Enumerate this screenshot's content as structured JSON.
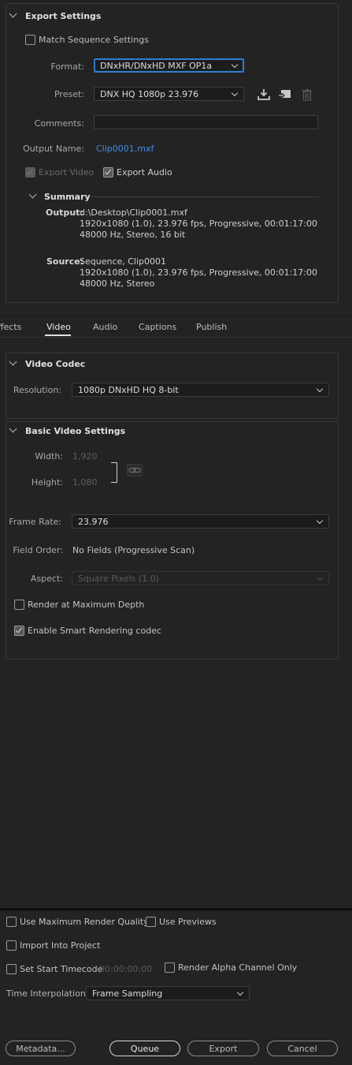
{
  "export_settings": {
    "title": "Export Settings",
    "match_sequence_label": "Match Sequence Settings",
    "format_label": "Format:",
    "format_value": "DNxHR/DNxHD MXF OP1a",
    "preset_label": "Preset:",
    "preset_value": "DNX HQ 1080p 23.976",
    "comments_label": "Comments:",
    "comments_value": "",
    "output_name_label": "Output Name:",
    "output_name_value": "Clip0001.mxf",
    "export_video_label": "Export Video",
    "export_audio_label": "Export Audio"
  },
  "summary": {
    "title": "Summary",
    "output_label": "Output:",
    "output_lines": [
      "d:\\Desktop\\Clip0001.mxf",
      "1920x1080 (1.0), 23.976 fps, Progressive, 00:01:17:00",
      "48000 Hz, Stereo, 16 bit"
    ],
    "source_label": "Source:",
    "source_lines": [
      "Sequence, Clip0001",
      "1920x1080 (1.0), 23.976 fps, Progressive, 00:01:17:00",
      "48000 Hz, Stereo"
    ]
  },
  "tabs": [
    "Effects",
    "Video",
    "Audio",
    "Captions",
    "Publish"
  ],
  "video_codec": {
    "title": "Video Codec",
    "resolution_label": "Resolution:",
    "resolution_value": "1080p DNxHD HQ 8-bit"
  },
  "basic_video": {
    "title": "Basic Video Settings",
    "width_label": "Width:",
    "width_value": "1,920",
    "height_label": "Height:",
    "height_value": "1,080",
    "frame_rate_label": "Frame Rate:",
    "frame_rate_value": "23.976",
    "field_order_label": "Field Order:",
    "field_order_value": "No Fields (Progressive Scan)",
    "aspect_label": "Aspect:",
    "aspect_value": "Square Pixels (1.0)",
    "render_max_depth_label": "Render at Maximum Depth",
    "smart_rendering_label": "Enable Smart Rendering codec"
  },
  "bottom": {
    "max_render_quality_label": "Use Maximum Render Quality",
    "use_previews_label": "Use Previews",
    "import_into_project_label": "Import Into Project",
    "set_start_timecode_label": "Set Start Timecode",
    "timecode_value": "00:00:00:00",
    "render_alpha_label": "Render Alpha Channel Only",
    "time_interpolation_label": "Time Interpolation:",
    "time_interpolation_value": "Frame Sampling"
  },
  "buttons": {
    "metadata": "Metadata...",
    "queue": "Queue",
    "export": "Export",
    "cancel": "Cancel"
  },
  "colors": {
    "background": "#232323",
    "accent_link": "#3d8fe6",
    "focus": "#2f7bd6"
  }
}
